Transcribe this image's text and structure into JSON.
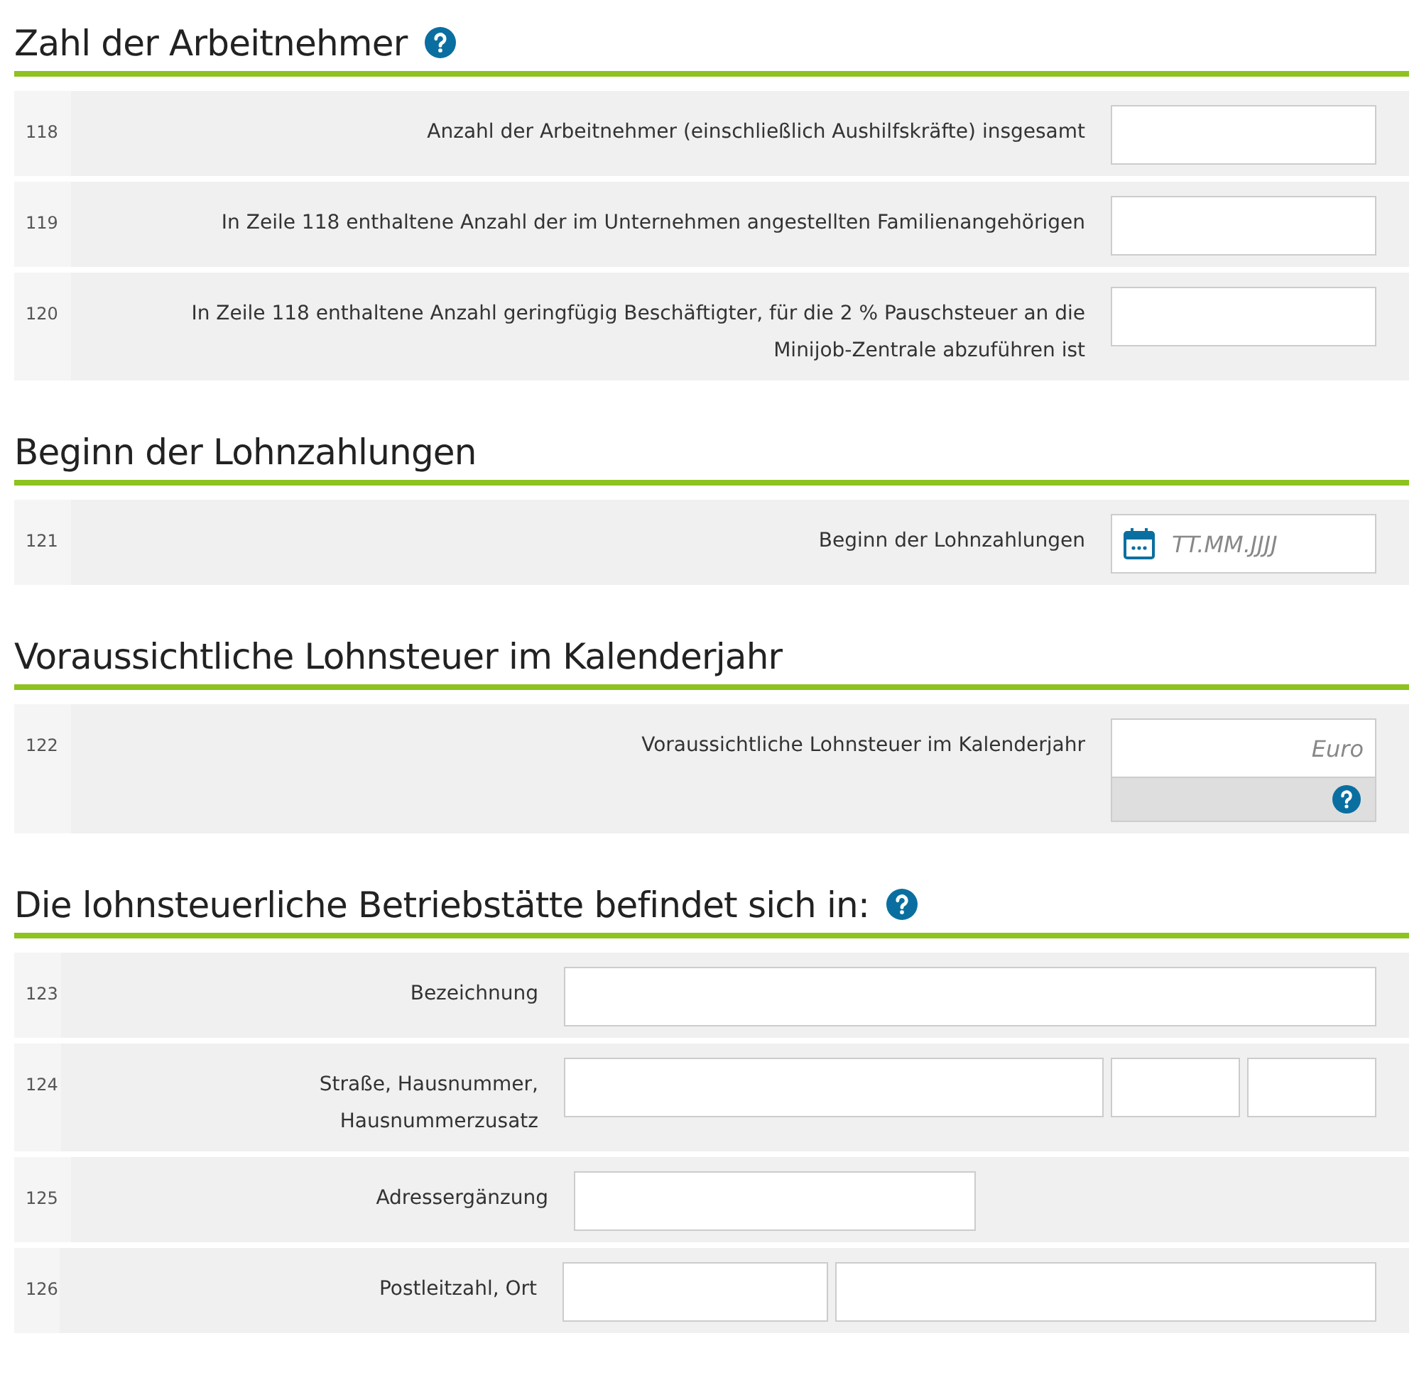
{
  "sections": [
    {
      "title": "Zahl der Arbeitnehmer",
      "help": true,
      "rows": [
        {
          "number": "118",
          "kind": "short",
          "label": "Anzahl der Arbeitnehmer (einschließlich Aushilfskräfte) insgesamt",
          "fields": [
            {
              "kind": "text"
            }
          ]
        },
        {
          "number": "119",
          "kind": "short",
          "label": "In Zeile 118 enthaltene Anzahl der im Unternehmen angestellten Familienangehörigen",
          "fields": [
            {
              "kind": "text"
            }
          ]
        },
        {
          "number": "120",
          "kind": "short",
          "label": "In Zeile 118 enthaltene Anzahl geringfügig Beschäftigter, für die 2 % Pauschsteuer an die Minijob-Zentrale abzuführen ist",
          "fields": [
            {
              "kind": "text"
            }
          ]
        }
      ]
    },
    {
      "title": "Beginn der Lohnzahlungen",
      "help": false,
      "rows": [
        {
          "number": "121",
          "kind": "short",
          "label": "Beginn der Lohnzahlungen",
          "fields": [
            {
              "kind": "date",
              "placeholder": "TT.MM.JJJJ"
            }
          ]
        }
      ]
    },
    {
      "title": "Voraussichtliche Lohnsteuer im Kalenderjahr",
      "help": false,
      "rows": [
        {
          "number": "122",
          "kind": "short",
          "label": "Voraussichtliche Lohnsteuer im Kalenderjahr",
          "fields": [
            {
              "kind": "amount",
              "placeholder": "Euro",
              "help": true
            }
          ]
        }
      ]
    },
    {
      "title": "Die lohnsteuerliche Betriebstätte befindet sich in:",
      "help": true,
      "rows": [
        {
          "number": "123",
          "kind": "long",
          "label": "Bezeichnung",
          "fields": [
            {
              "kind": "full"
            }
          ]
        },
        {
          "number": "124",
          "kind": "long",
          "label": "Straße,  Hausnummer, Hausnummerzusatz",
          "fields": [
            {
              "kind": "street"
            },
            {
              "kind": "small"
            },
            {
              "kind": "small"
            }
          ]
        },
        {
          "number": "125",
          "kind": "long",
          "label": "Adressergänzung",
          "fields": [
            {
              "kind": "half"
            }
          ]
        },
        {
          "number": "126",
          "kind": "long",
          "label": "Postleitzahl,  Ort",
          "fields": [
            {
              "kind": "postal"
            },
            {
              "kind": "city"
            }
          ]
        }
      ]
    }
  ]
}
